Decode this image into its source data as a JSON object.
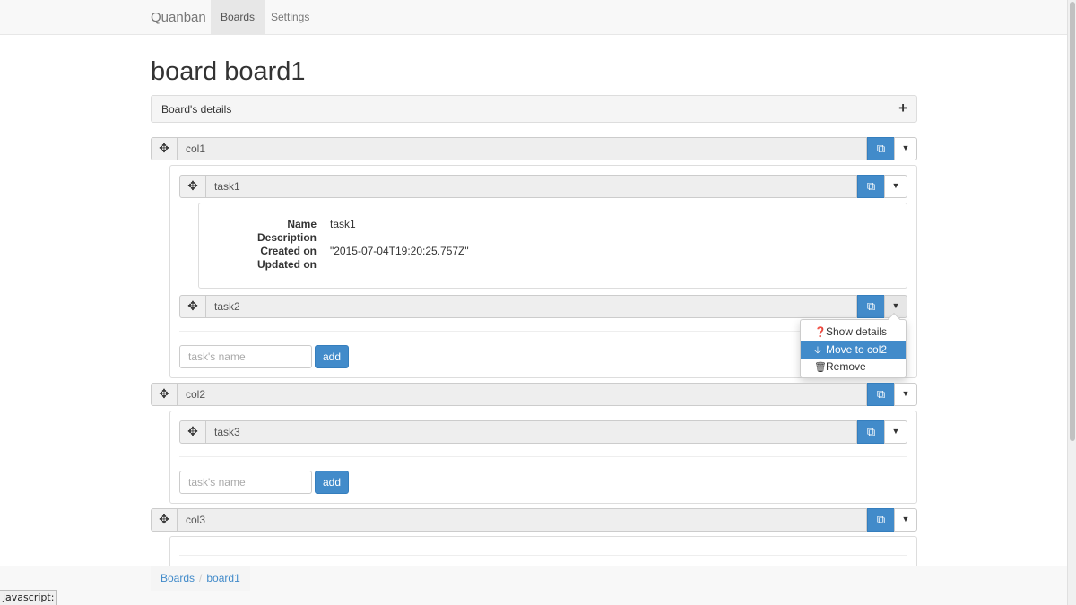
{
  "navbar": {
    "brand": "Quanban",
    "items": [
      {
        "label": "Boards",
        "active": true
      },
      {
        "label": "Settings",
        "active": false
      }
    ]
  },
  "page": {
    "title": "board board1",
    "details_label": "Board's details",
    "details_toggle": "+"
  },
  "columns": [
    {
      "name": "col1",
      "tasks": [
        {
          "name": "task1",
          "details": {
            "name_label": "Name",
            "name_value": "task1",
            "description_label": "Description",
            "description_value": "",
            "created_label": "Created on",
            "created_value": "\"2015-07-04T19:20:25.757Z\"",
            "updated_label": "Updated on",
            "updated_value": ""
          }
        },
        {
          "name": "task2"
        }
      ],
      "input_placeholder": "task's name",
      "add_label": "add"
    },
    {
      "name": "col2",
      "tasks": [
        {
          "name": "task3"
        }
      ],
      "input_placeholder": "task's name",
      "add_label": "add"
    },
    {
      "name": "col3",
      "tasks": []
    }
  ],
  "dropdown": {
    "items": [
      {
        "label": "Show details",
        "icon": "question-circle-icon"
      },
      {
        "label": "Move to col2",
        "icon": "arrow-down-icon",
        "active": true
      },
      {
        "label": "Remove",
        "icon": "trash-icon"
      }
    ]
  },
  "breadcrumb": [
    "Boards",
    "board1"
  ],
  "status_bar": "javascript:",
  "colors": {
    "primary": "#428bca",
    "navbar": "#f8f8f8"
  }
}
